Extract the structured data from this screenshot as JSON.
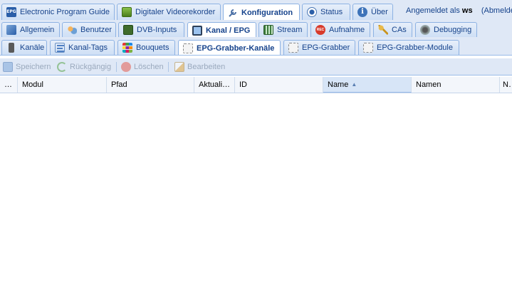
{
  "main_tabs": [
    {
      "label": "Electronic Program Guide",
      "icon": "epg-icon",
      "active": false
    },
    {
      "label": "Digitaler Videorekorder",
      "icon": "dvr-icon",
      "active": false
    },
    {
      "label": "Konfiguration",
      "icon": "wrench-icon",
      "active": true
    },
    {
      "label": "Status",
      "icon": "eye-icon",
      "active": false
    },
    {
      "label": "Über",
      "icon": "info-icon",
      "active": false
    }
  ],
  "user": {
    "prefix": "Angemeldet als",
    "name": "ws",
    "logout": "(Abmelden)"
  },
  "config_tabs": [
    {
      "label": "Allgemein",
      "icon": "tools-icon"
    },
    {
      "label": "Benutzer",
      "icon": "users-icon"
    },
    {
      "label": "DVB-Inputs",
      "icon": "dvb-card-icon"
    },
    {
      "label": "Kanal / EPG",
      "icon": "tv-icon",
      "active": true
    },
    {
      "label": "Stream",
      "icon": "stream-icon"
    },
    {
      "label": "Aufnahme",
      "icon": "rec-icon"
    },
    {
      "label": "CAs",
      "icon": "key-icon"
    },
    {
      "label": "Debugging",
      "icon": "bug-icon"
    }
  ],
  "channel_tabs": [
    {
      "label": "Kanäle",
      "icon": "remote-icon"
    },
    {
      "label": "Kanal-Tags",
      "icon": "tags-icon"
    },
    {
      "label": "Bouquets",
      "icon": "bouquet-icon"
    },
    {
      "label": "EPG-Grabber-Kanäle",
      "icon": "grabber-icon",
      "active": true
    },
    {
      "label": "EPG-Grabber",
      "icon": "grabber-icon"
    },
    {
      "label": "EPG-Grabber-Module",
      "icon": "grabber-icon"
    }
  ],
  "toolbar": {
    "save": "Speichern",
    "undo": "Rückgängig",
    "delete": "Löschen",
    "edit": "Bearbeiten"
  },
  "columns": [
    "…",
    "Modul",
    "Pfad",
    "Aktuali…",
    "ID",
    "Name",
    "Namen",
    "N…"
  ],
  "sorted_column": "Name",
  "colors": {
    "tab_bg": "#dfe8f6",
    "border": "#99bbe8",
    "text": "#15428b"
  }
}
